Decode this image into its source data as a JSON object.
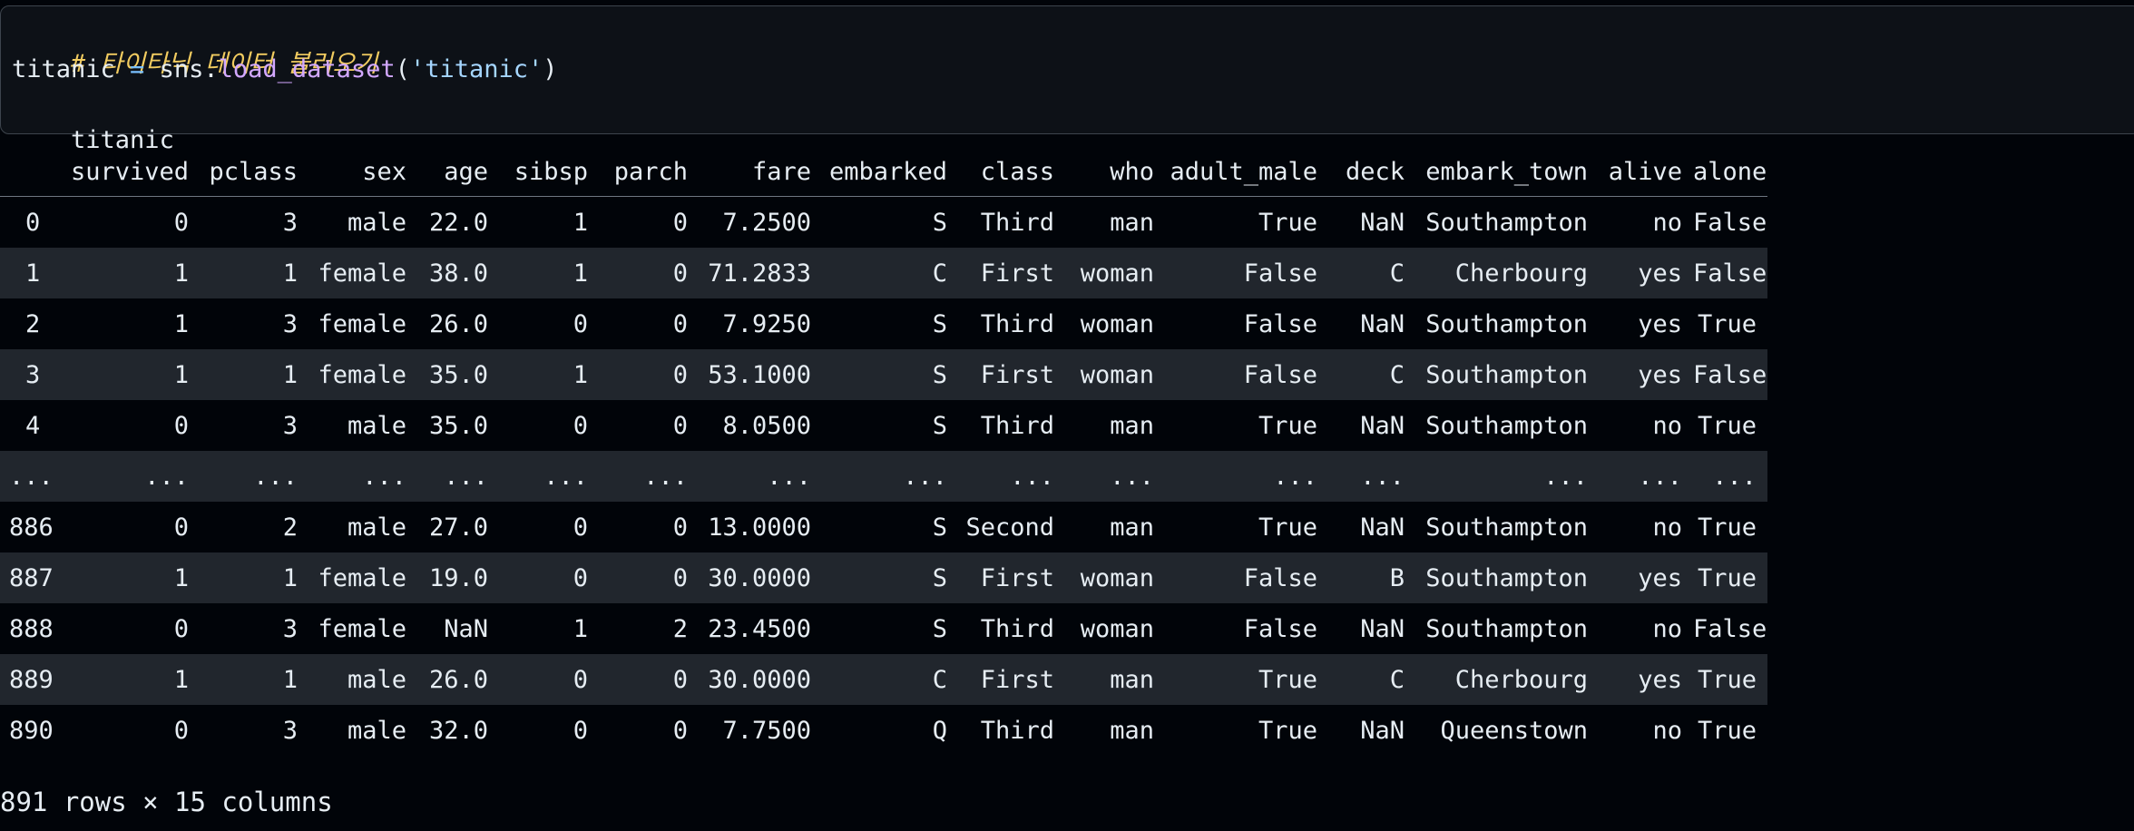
{
  "code_cell": {
    "comment": "# 타이타닉 데이터 불러오기",
    "line2": {
      "var": "titanic ",
      "op": "=",
      "obj": " sns.",
      "func": "load_dataset",
      "open": "(",
      "arg": "'titanic'",
      "close": ")"
    },
    "line3": "titanic"
  },
  "dataframe": {
    "columns": [
      "",
      "survived",
      "pclass",
      "sex",
      "age",
      "sibsp",
      "parch",
      "fare",
      "embarked",
      "class",
      "who",
      "adult_male",
      "deck",
      "embark_town",
      "alive",
      "alone"
    ],
    "rows": [
      [
        "0",
        "0",
        "3",
        "male",
        "22.0",
        "1",
        "0",
        "7.2500",
        "S",
        "Third",
        "man",
        "True",
        "NaN",
        "Southampton",
        "no",
        "False"
      ],
      [
        "1",
        "1",
        "1",
        "female",
        "38.0",
        "1",
        "0",
        "71.2833",
        "C",
        "First",
        "woman",
        "False",
        "C",
        "Cherbourg",
        "yes",
        "False"
      ],
      [
        "2",
        "1",
        "3",
        "female",
        "26.0",
        "0",
        "0",
        "7.9250",
        "S",
        "Third",
        "woman",
        "False",
        "NaN",
        "Southampton",
        "yes",
        "True"
      ],
      [
        "3",
        "1",
        "1",
        "female",
        "35.0",
        "1",
        "0",
        "53.1000",
        "S",
        "First",
        "woman",
        "False",
        "C",
        "Southampton",
        "yes",
        "False"
      ],
      [
        "4",
        "0",
        "3",
        "male",
        "35.0",
        "0",
        "0",
        "8.0500",
        "S",
        "Third",
        "man",
        "True",
        "NaN",
        "Southampton",
        "no",
        "True"
      ],
      [
        "...",
        "...",
        "...",
        "...",
        "...",
        "...",
        "...",
        "...",
        "...",
        "...",
        "...",
        "...",
        "...",
        "...",
        "...",
        "..."
      ],
      [
        "886",
        "0",
        "2",
        "male",
        "27.0",
        "0",
        "0",
        "13.0000",
        "S",
        "Second",
        "man",
        "True",
        "NaN",
        "Southampton",
        "no",
        "True"
      ],
      [
        "887",
        "1",
        "1",
        "female",
        "19.0",
        "0",
        "0",
        "30.0000",
        "S",
        "First",
        "woman",
        "False",
        "B",
        "Southampton",
        "yes",
        "True"
      ],
      [
        "888",
        "0",
        "3",
        "female",
        "NaN",
        "1",
        "2",
        "23.4500",
        "S",
        "Third",
        "woman",
        "False",
        "NaN",
        "Southampton",
        "no",
        "False"
      ],
      [
        "889",
        "1",
        "1",
        "male",
        "26.0",
        "0",
        "0",
        "30.0000",
        "C",
        "First",
        "man",
        "True",
        "C",
        "Cherbourg",
        "yes",
        "True"
      ],
      [
        "890",
        "0",
        "3",
        "male",
        "32.0",
        "0",
        "0",
        "7.7500",
        "Q",
        "Third",
        "man",
        "True",
        "NaN",
        "Queenstown",
        "no",
        "True"
      ]
    ],
    "summary": "891 rows × 15 columns"
  }
}
